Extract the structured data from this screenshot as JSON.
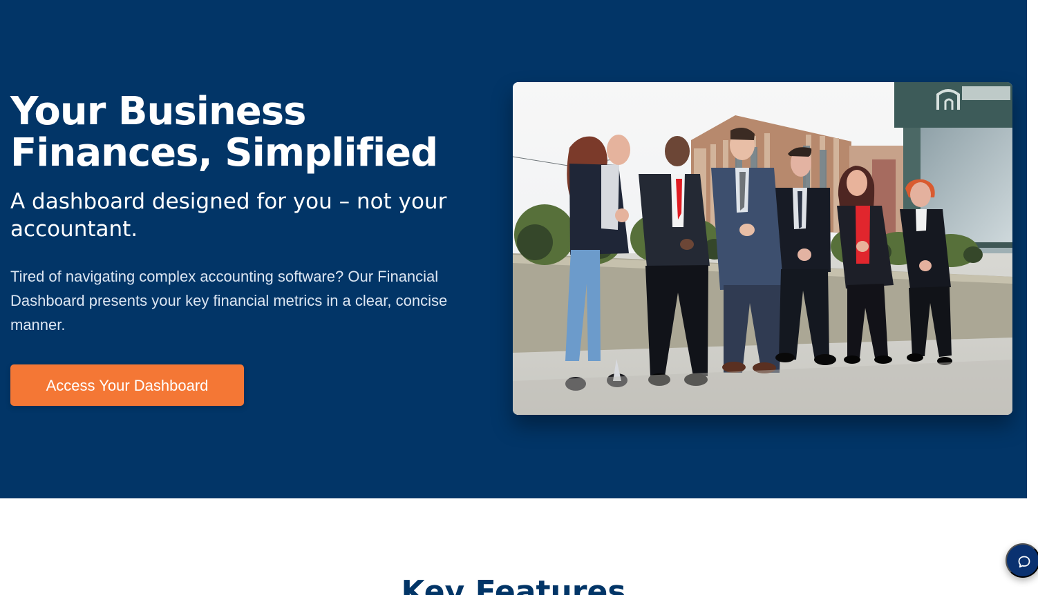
{
  "hero": {
    "title": "Your Business Finances, Simplified",
    "subtitle": "A dashboard designed for you – not your accountant.",
    "body": "Tired of navigating complex accounting software? Our Financial Dashboard presents your key financial metrics in a clear, concise manner.",
    "cta_label": "Access Your Dashboard",
    "photo_alt": "Team photo of six people standing outside a building"
  },
  "features": {
    "heading": "Key Features"
  },
  "chat": {
    "icon": "chat-bubble-icon"
  },
  "colors": {
    "hero_background": "#023567",
    "cta_background": "#f47735",
    "heading_text": "#023567",
    "chat_button": "#0a3170"
  }
}
